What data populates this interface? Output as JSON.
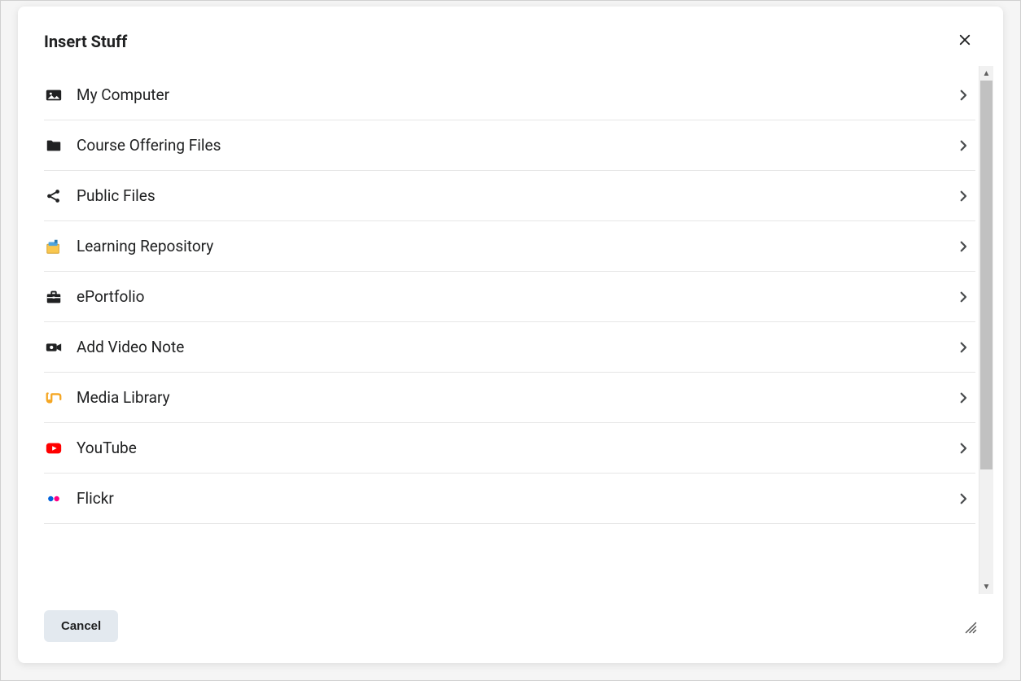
{
  "modal": {
    "title": "Insert Stuff",
    "cancel_label": "Cancel",
    "items": [
      {
        "label": "My Computer",
        "icon": "image-icon"
      },
      {
        "label": "Course Offering Files",
        "icon": "folder-icon"
      },
      {
        "label": "Public Files",
        "icon": "share-icon"
      },
      {
        "label": "Learning Repository",
        "icon": "repository-icon"
      },
      {
        "label": "ePortfolio",
        "icon": "briefcase-icon"
      },
      {
        "label": "Add Video Note",
        "icon": "video-camera-icon"
      },
      {
        "label": "Media Library",
        "icon": "media-library-icon"
      },
      {
        "label": "YouTube",
        "icon": "youtube-icon"
      },
      {
        "label": "Flickr",
        "icon": "flickr-icon"
      }
    ]
  }
}
